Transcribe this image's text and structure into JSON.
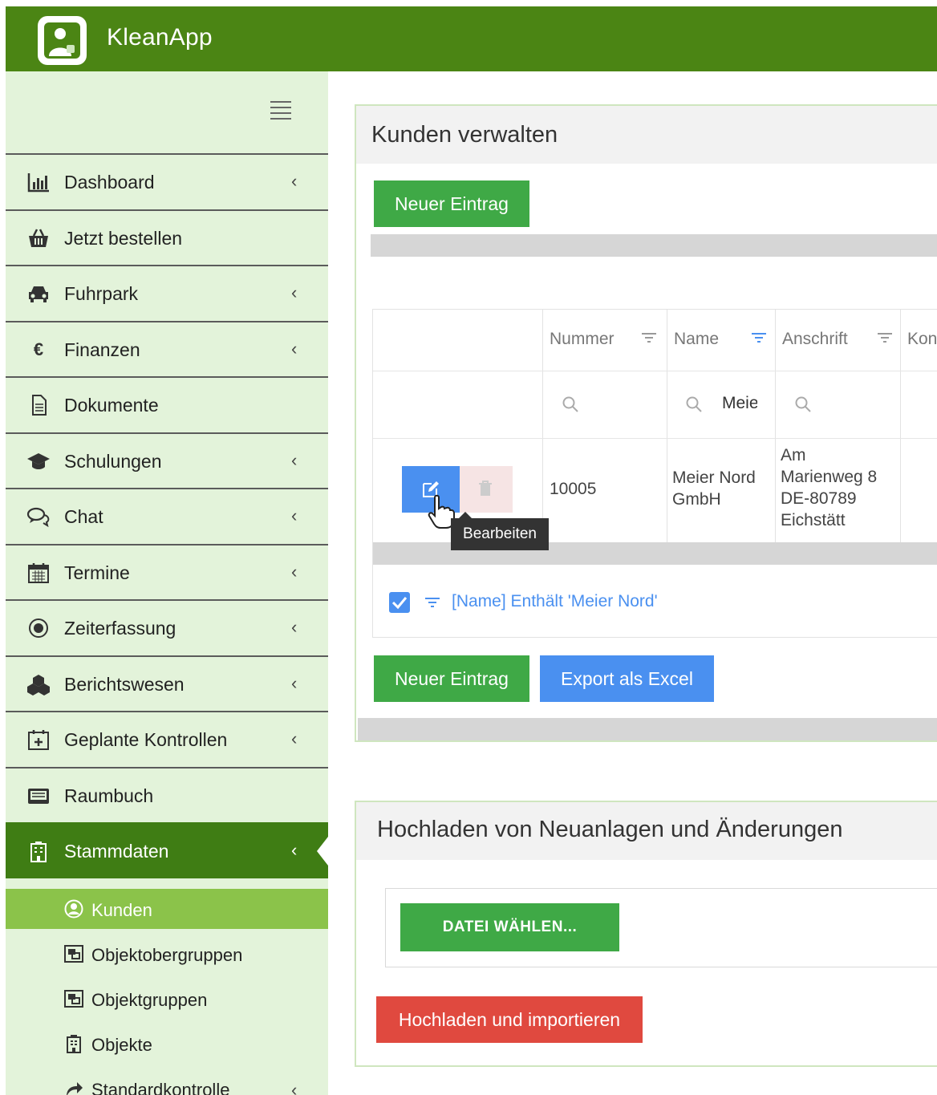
{
  "app": {
    "title": "KleanApp",
    "brand_color": "#4b8514",
    "accent_green": "#3fa946",
    "accent_blue": "#4a90f0",
    "danger_red": "#e0493f"
  },
  "sidebar": {
    "items": [
      {
        "label": "Dashboard",
        "icon": "bar-chart-icon",
        "chevron": "‹"
      },
      {
        "label": "Jetzt bestellen",
        "icon": "basket-icon",
        "chevron": ""
      },
      {
        "label": "Fuhrpark",
        "icon": "car-icon",
        "chevron": "‹"
      },
      {
        "label": "Finanzen",
        "icon": "euro-icon",
        "chevron": "‹"
      },
      {
        "label": "Dokumente",
        "icon": "document-icon",
        "chevron": ""
      },
      {
        "label": "Schulungen",
        "icon": "graduation-cap-icon",
        "chevron": "‹"
      },
      {
        "label": "Chat",
        "icon": "chat-icon",
        "chevron": "‹"
      },
      {
        "label": "Termine",
        "icon": "calendar-icon",
        "chevron": "‹"
      },
      {
        "label": "Zeiterfassung",
        "icon": "target-icon",
        "chevron": "‹"
      },
      {
        "label": "Berichtswesen",
        "icon": "cubes-icon",
        "chevron": "‹"
      },
      {
        "label": "Geplante Kontrollen",
        "icon": "calendar-plus-icon",
        "chevron": "‹"
      },
      {
        "label": "Raumbuch",
        "icon": "book-icon",
        "chevron": ""
      },
      {
        "label": "Stammdaten",
        "icon": "building-icon",
        "chevron": "‹"
      }
    ],
    "sub_items": [
      {
        "label": "Kunden",
        "icon": "user-circle-icon",
        "chevron": ""
      },
      {
        "label": "Objektobergruppen",
        "icon": "object-group-icon",
        "chevron": ""
      },
      {
        "label": "Objektgruppen",
        "icon": "object-group-icon",
        "chevron": ""
      },
      {
        "label": "Objekte",
        "icon": "building-icon",
        "chevron": ""
      },
      {
        "label": "Standardkontrolle",
        "icon": "share-icon",
        "chevron": "‹"
      }
    ]
  },
  "customers": {
    "title": "Kunden verwalten",
    "new_button": "Neuer Eintrag",
    "export_button": "Export als Excel",
    "columns": [
      "Nummer",
      "Name",
      "Anschrift",
      "Kon"
    ],
    "search_name_value": "Meie",
    "row": {
      "nummer": "10005",
      "name_line1": "Meier Nord",
      "name_line2": "GmbH",
      "address": [
        "Am",
        "Marienweg 8",
        "DE-80789",
        "Eichstätt"
      ]
    },
    "tooltip": "Bearbeiten",
    "filter_text": "[Name] Enthält 'Meier Nord'"
  },
  "upload": {
    "title": "Hochladen von Neuanlagen und Änderungen",
    "choose_file_button": "DATEI WÄHLEN...",
    "upload_button": "Hochladen und importieren"
  }
}
